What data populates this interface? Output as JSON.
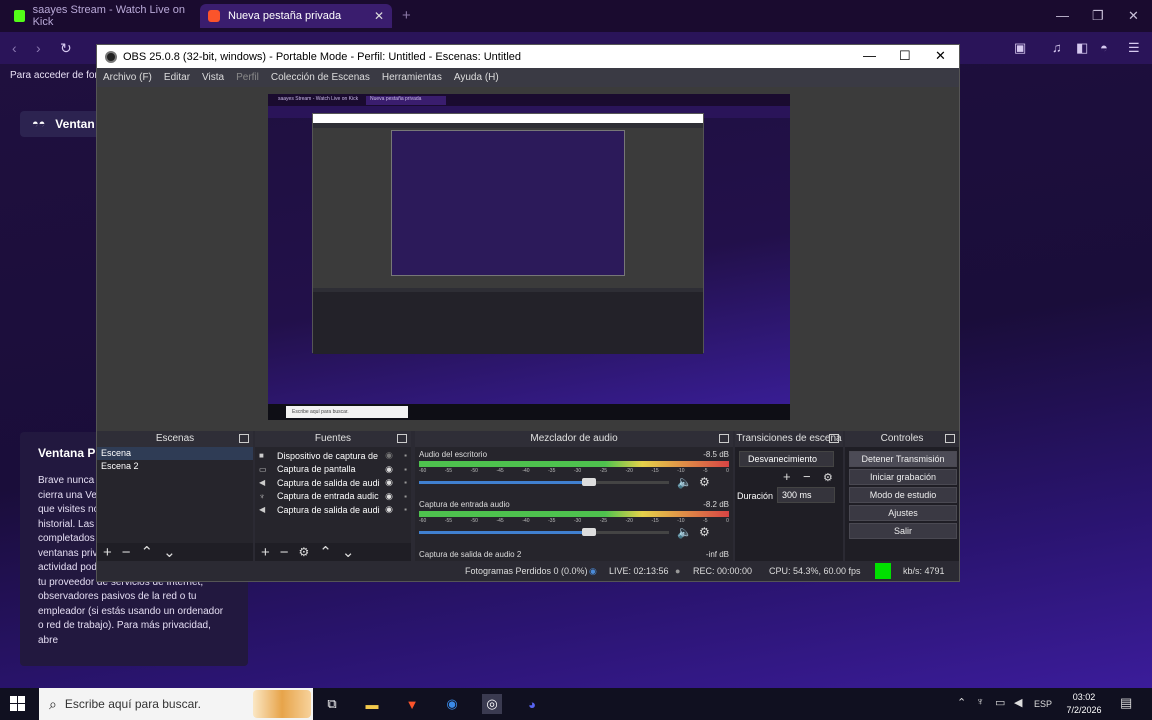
{
  "browser": {
    "tabs": [
      {
        "title": "saayes Stream - Watch Live on Kick",
        "active": false
      },
      {
        "title": "Nueva pestaña privada",
        "active": true
      }
    ],
    "bookmark_text": "Para acceder de form",
    "private_header": "Ventan",
    "private_card": {
      "title": "Ventana P",
      "body": "Brave nunca recuerda tu actividad. Se cierra una Ventana privada, las páginas que visites no se mantendrán en tu historial. Las cookies, caché y formularios completados desaparecen al cerrar las ventanas privadas. Ten en cuenta que tu actividad podría seguir siendo visible para tu proveedor de servicios de Internet, observadores pasivos de la red o tu empleador (si estás usando un ordenador o red de trabajo). Para más privacidad, abre"
    }
  },
  "obs": {
    "title": "OBS 25.0.8 (32-bit, windows) - Portable Mode - Perfil: Untitled - Escenas: Untitled",
    "menu": [
      "Archivo (F)",
      "Editar",
      "Vista",
      "Perfil",
      "Colección de Escenas",
      "Herramientas",
      "Ayuda (H)"
    ],
    "docks": {
      "scenes": {
        "title": "Escenas",
        "items": [
          "Escena",
          "Escena 2"
        ]
      },
      "sources": {
        "title": "Fuentes",
        "items": [
          "Dispositivo de captura de",
          "Captura de pantalla",
          "Captura de salida de audi",
          "Captura de entrada audic",
          "Captura de salida de audi"
        ]
      },
      "mixer": {
        "title": "Mezclador de audio",
        "tracks": [
          {
            "name": "Audio del escritorio",
            "db": "-8.5 dB",
            "level": 0.68
          },
          {
            "name": "Captura de entrada audio",
            "db": "-8.2 dB",
            "level": 0.68
          },
          {
            "name": "Captura de salida de audio 2",
            "db": "-inf dB",
            "level": 0
          }
        ],
        "ticks": [
          "-60",
          "-55",
          "-50",
          "-45",
          "-40",
          "-35",
          "-30",
          "-25",
          "-20",
          "-15",
          "-10",
          "-5",
          "0"
        ]
      },
      "transitions": {
        "title": "Transiciones de escena",
        "selected": "Desvanecimiento",
        "duration_label": "Duración",
        "duration": "300 ms"
      },
      "controls": {
        "title": "Controles",
        "buttons": [
          "Detener Transmisión",
          "Iniciar grabación",
          "Modo de estudio",
          "Ajustes",
          "Salir"
        ]
      }
    },
    "status": {
      "dropped": "Fotogramas Perdidos 0 (0.0%)",
      "live": "LIVE: 02:13:56",
      "rec": "REC: 00:00:00",
      "cpu": "CPU: 54.3%, 60.00 fps",
      "kbps": "kb/s: 4791",
      "indicator_color": "#00e000"
    }
  },
  "preview_mirror": {
    "tab1": "saayes Stream - Watch Live on Kick",
    "tab2": "Nueva pestaña privada",
    "search": "Escribe aquí para buscar."
  },
  "taskbar": {
    "search_placeholder": "Escribe aquí para buscar.",
    "lang": "ESP",
    "time": "03:02",
    "date": "7/2/2026"
  }
}
